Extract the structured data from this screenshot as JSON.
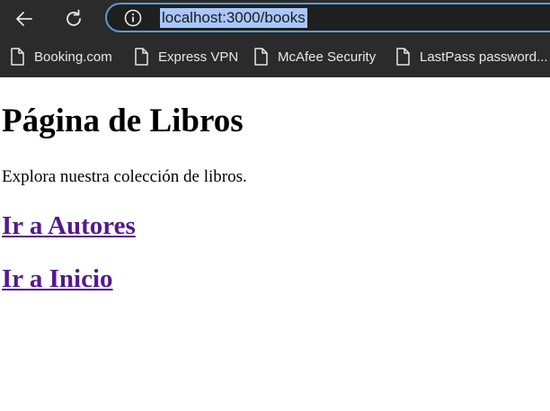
{
  "browser": {
    "url": "localhost:3000/books",
    "bookmarks": [
      {
        "label": "Booking.com",
        "icon": "page-icon"
      },
      {
        "label": "Express VPN",
        "icon": "page-icon"
      },
      {
        "label": "McAfee Security",
        "icon": "page-icon"
      },
      {
        "label": "LastPass password...",
        "icon": "page-icon"
      }
    ],
    "icons": {
      "back": "back-arrow-icon",
      "reload": "reload-icon",
      "site_info": "info-icon"
    },
    "colors": {
      "chrome_bg": "#2b2b2b",
      "address_border": "#5b9bd5",
      "url_highlight": "#a8c7fa",
      "visited_link": "#551a8b"
    }
  },
  "page": {
    "title": "Página de Libros",
    "description": "Explora nuestra colección de libros.",
    "links": [
      {
        "label": "Ir a Autores"
      },
      {
        "label": "Ir a Inicio"
      }
    ]
  }
}
